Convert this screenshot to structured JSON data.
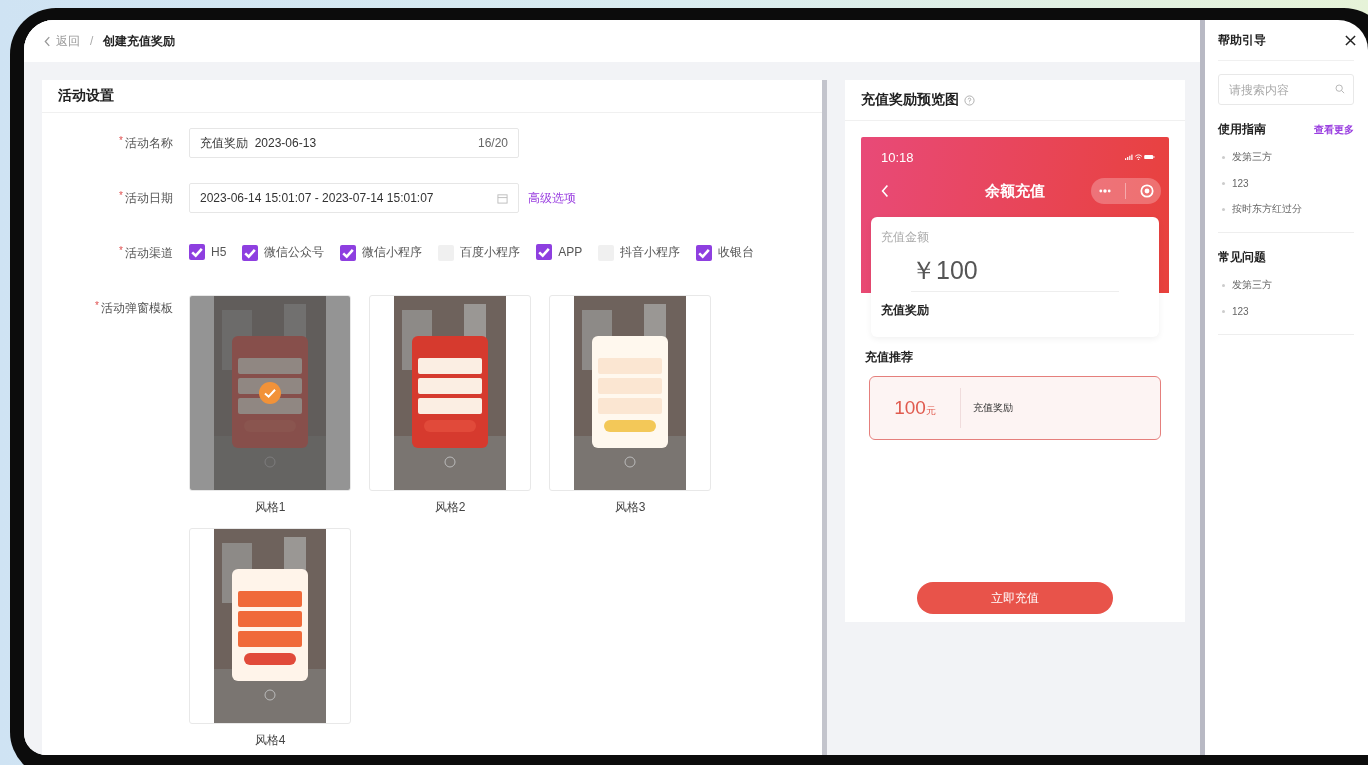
{
  "breadcrumb": {
    "back": "返回",
    "separator": "/",
    "current": "创建充值奖励"
  },
  "settings": {
    "title": "活动设置",
    "fields": [
      {
        "kind": "text",
        "mark": "*",
        "label": "活动名称",
        "value": "充值奖励  2023-06-13",
        "counter": "16/20"
      },
      {
        "kind": "date",
        "mark": "*",
        "label": "活动日期",
        "value": "2023-06-14 15:01:07 - 2023-07-14 15:01:07",
        "link": "高级选项"
      },
      {
        "kind": "checkboxes",
        "mark": "*",
        "label": "活动渠道",
        "options": [
          {
            "label": "H5",
            "checked": true
          },
          {
            "label": "微信公众号",
            "checked": true
          },
          {
            "label": "微信小程序",
            "checked": true
          },
          {
            "label": "百度小程序",
            "checked": false
          },
          {
            "label": "APP",
            "checked": true
          },
          {
            "label": "抖音小程序",
            "checked": false
          },
          {
            "label": "收银台",
            "checked": true
          }
        ]
      },
      {
        "kind": "templates",
        "mark": "*",
        "label": "活动弹窗模板",
        "templates": [
          {
            "label": "风格1",
            "selected": true
          },
          {
            "label": "风格2",
            "selected": false
          },
          {
            "label": "风格3",
            "selected": false
          },
          {
            "label": "风格4",
            "selected": false
          }
        ]
      }
    ]
  },
  "preview": {
    "title": "充值奖励预览图",
    "phone": {
      "time": "10:18",
      "title": "余额充值",
      "amount_label": "充值金额",
      "amount": "￥100",
      "reward_label": "充值奖励",
      "recommend_title": "充值推荐",
      "option": {
        "amount": "100",
        "unit": "元",
        "text": "充值奖励"
      },
      "button": "立即充值"
    }
  },
  "help": {
    "title": "帮助引导",
    "search": {
      "placeholder": "请搜索内容"
    },
    "sections": [
      {
        "title": "使用指南",
        "more": "查看更多",
        "items": [
          "发第三方",
          "123",
          "按时东方红过分"
        ]
      },
      {
        "title": "常见问题",
        "items": [
          "发第三方",
          "123"
        ]
      }
    ]
  }
}
